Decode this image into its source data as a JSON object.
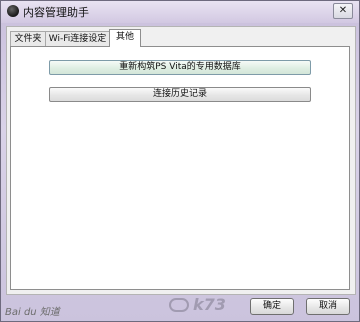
{
  "window": {
    "title": "内容管理助手",
    "close_glyph": "✕"
  },
  "tabs": [
    {
      "label": "文件夹",
      "active": false
    },
    {
      "label": "Wi-Fi连接设定",
      "active": false
    },
    {
      "label": "其他",
      "active": true
    }
  ],
  "panel": {
    "rebuild_db_button": "重新构筑PS Vita的专用数据库",
    "history_button": "连接历史记录"
  },
  "footer": {
    "ok_label": "确定",
    "cancel_label": "取消"
  },
  "watermarks": {
    "baidu": "Bai du 知道",
    "k73": "k73"
  },
  "icons": {
    "app": "app-icon",
    "close": "close-icon"
  }
}
